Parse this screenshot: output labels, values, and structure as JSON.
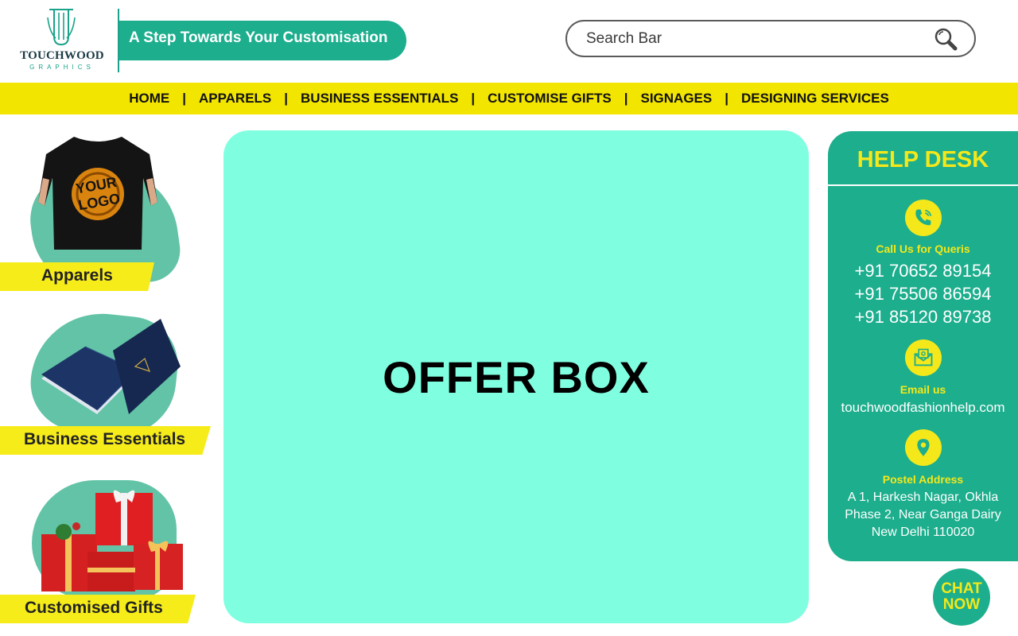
{
  "brand": {
    "name": "TOUCHWOOD",
    "sub": "GRAPHICS",
    "tagline": "A Step Towards Your Customisation"
  },
  "search": {
    "placeholder": "Search Bar"
  },
  "nav": {
    "items": [
      "HOME",
      "APPARELS",
      "BUSINESS ESSENTIALS",
      "CUSTOMISE GIFTS",
      "SIGNAGES",
      "DESIGNING SERVICES"
    ],
    "separator": "|"
  },
  "categories": [
    {
      "label": "Apparels",
      "image_text": "YOUR LOGO"
    },
    {
      "label": "Business Essentials"
    },
    {
      "label": "Customised Gifts"
    }
  ],
  "offer": {
    "title": "OFFER BOX"
  },
  "help": {
    "title": "HELP DESK",
    "call_label": "Call Us for Queris",
    "phones": [
      "+91 70652 89154",
      "+91 75506 86594",
      "+91 85120 89738"
    ],
    "email_label": "Email us",
    "email": "touchwoodfashionhelp.com",
    "address_label": "Postel Address",
    "address_lines": [
      "A 1, Harkesh Nagar, Okhla",
      "Phase 2, Near Ganga Dairy",
      "New Delhi 110020"
    ]
  },
  "chat": {
    "line1": "CHAT",
    "line2": "NOW"
  },
  "colors": {
    "teal": "#1cae8d",
    "yellow": "#f2e500",
    "offer_bg": "#80ffe0",
    "blob": "#62c3a6"
  }
}
